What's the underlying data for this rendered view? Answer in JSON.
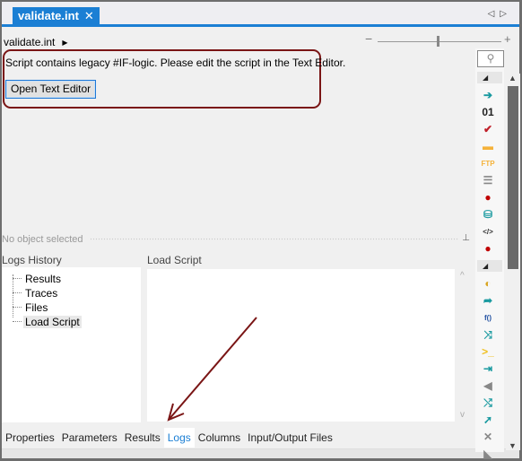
{
  "tab": {
    "title": "validate.int",
    "close_glyph": "✕"
  },
  "tab_nav": {
    "prev": "◁",
    "next": "▷"
  },
  "breadcrumb": {
    "item": "validate.int",
    "arrow": "▶"
  },
  "zoom": {
    "minus": "−",
    "plus": "+",
    "level_fraction": 0.5
  },
  "notice": {
    "message": "Script contains legacy #IF-logic. Please edit the script in the Text Editor.",
    "button": "Open Text Editor"
  },
  "selection": {
    "status": "No object selected",
    "pin": "⊥"
  },
  "logs_history": {
    "label": "Logs History",
    "items": [
      {
        "label": "Results"
      },
      {
        "label": "Traces"
      },
      {
        "label": "Files"
      },
      {
        "label": "Load Script",
        "selected": true
      }
    ]
  },
  "load_script": {
    "label": "Load Script",
    "content": ""
  },
  "bottom_tabs": [
    {
      "label": "Properties"
    },
    {
      "label": "Parameters"
    },
    {
      "label": "Results"
    },
    {
      "label": "Logs",
      "active": true
    },
    {
      "label": "Columns"
    },
    {
      "label": "Input/Output Files"
    }
  ],
  "toolbox": {
    "search_glyph": "⚲",
    "group_glyph": "◢",
    "icons": [
      {
        "name": "import-file-icon",
        "glyph": "➔",
        "color": "#1a9aa0"
      },
      {
        "name": "binary-icon",
        "glyph": "01",
        "color": "#222222"
      },
      {
        "name": "validate-icon",
        "glyph": "✔",
        "color": "#c0202a"
      },
      {
        "name": "folder-icon",
        "glyph": "▬",
        "color": "#f5b23a"
      },
      {
        "name": "ftp-icon",
        "glyph": "FTP",
        "color": "#f5b23a"
      },
      {
        "name": "list-icon",
        "glyph": "☰",
        "color": "#888888"
      },
      {
        "name": "stop-icon",
        "glyph": "●",
        "color": "#c00000"
      },
      {
        "name": "database-import-icon",
        "glyph": "⛁",
        "color": "#1a9aa0"
      },
      {
        "name": "xml-file-icon",
        "glyph": "</>",
        "color": "#333333"
      },
      {
        "name": "stop-icon-2",
        "glyph": "●",
        "color": "#c00000"
      }
    ],
    "icons2": [
      {
        "name": "mask-icon",
        "glyph": "◐",
        "color": "#d9a520"
      },
      {
        "name": "redirect-arrow-icon",
        "glyph": "➦",
        "color": "#1a9aa0"
      },
      {
        "name": "function-icon",
        "glyph": "f()",
        "color": "#1f4fa0"
      },
      {
        "name": "merge-arrow-icon",
        "glyph": "⤨",
        "color": "#1a9aa0"
      },
      {
        "name": "terminal-icon",
        "glyph": ">_",
        "color": "#f0c020"
      },
      {
        "name": "ruler-arrow-icon",
        "glyph": "⇥",
        "color": "#1a9aa0"
      },
      {
        "name": "funnel-icon",
        "glyph": "◀",
        "color": "#888888"
      },
      {
        "name": "split-arrow-icon",
        "glyph": "⤭",
        "color": "#1a9aa0"
      },
      {
        "name": "forward-arrow-icon",
        "glyph": "➚",
        "color": "#1a9aa0"
      },
      {
        "name": "delete-icon",
        "glyph": "✕",
        "color": "#888888"
      },
      {
        "name": "partial-icon",
        "glyph": "◣",
        "color": "#888888"
      }
    ]
  },
  "scroll": {
    "up": "▲",
    "down": "▼",
    "script_up": "^",
    "script_down": "v"
  },
  "annotation": {
    "color": "#7a1515"
  }
}
